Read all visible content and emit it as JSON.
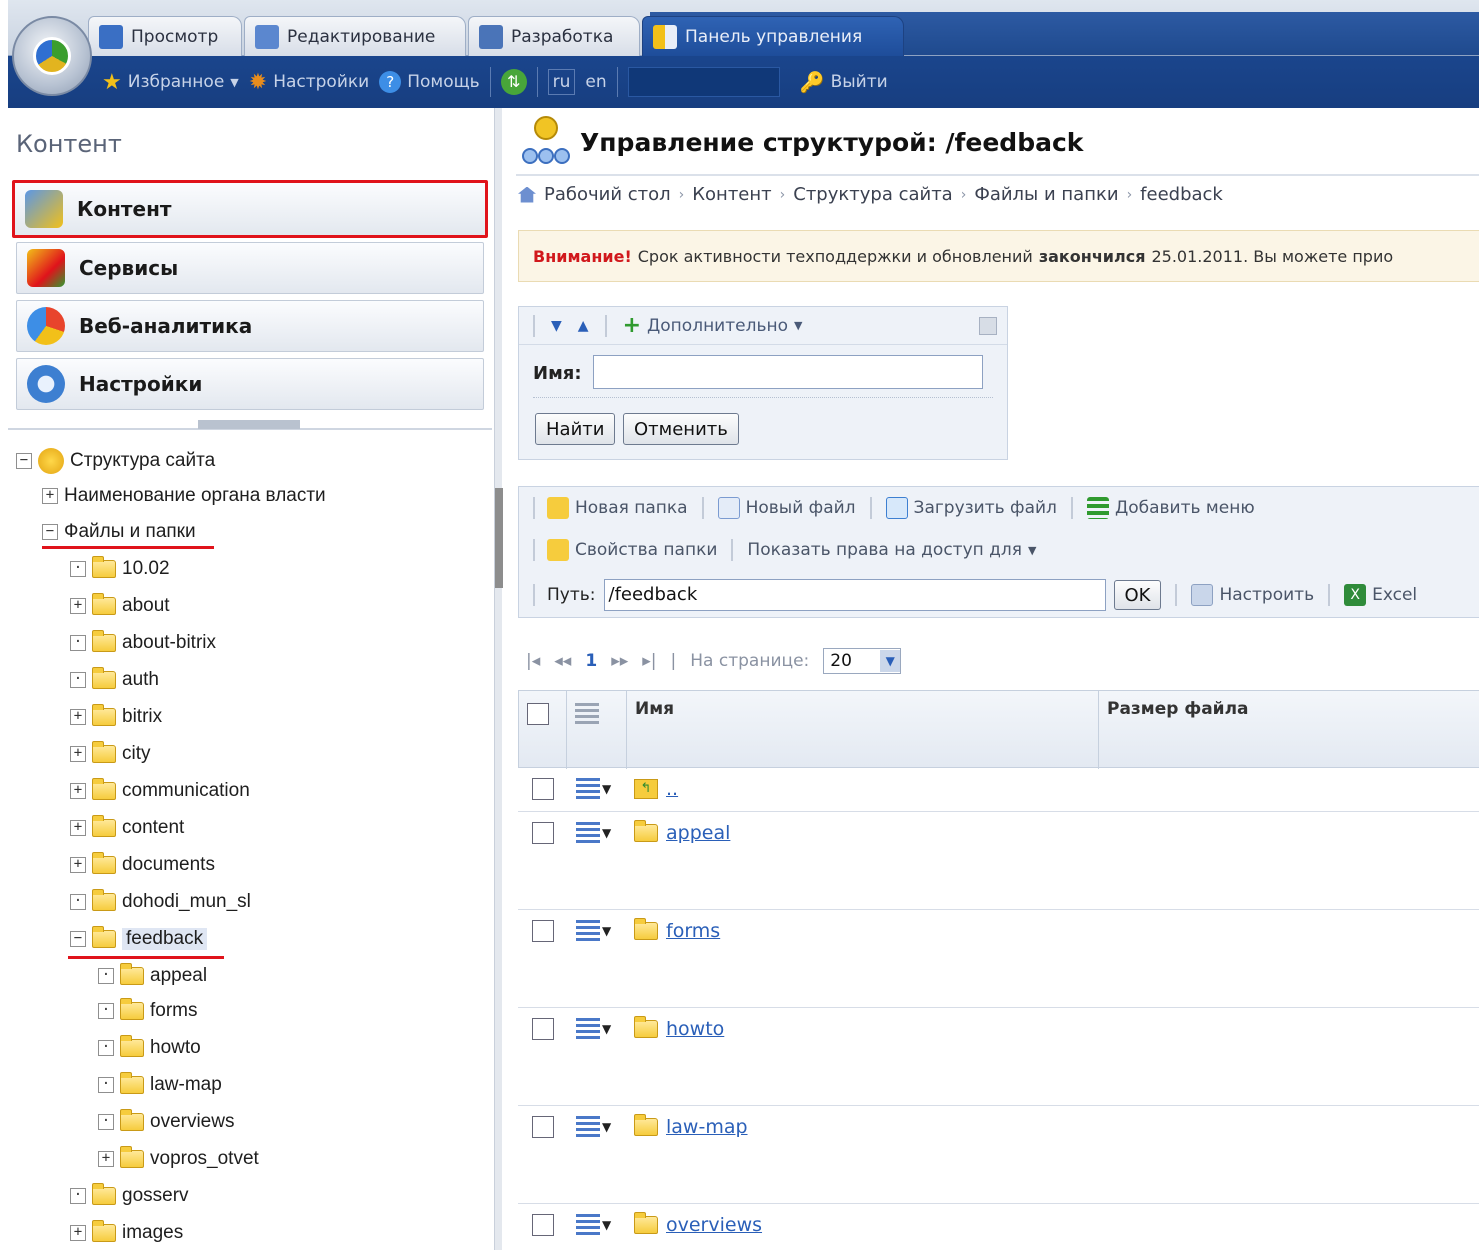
{
  "topbar": {
    "tabs": [
      {
        "label": "Просмотр",
        "icon": "monitor-icon"
      },
      {
        "label": "Редактирование",
        "icon": "edit-icon"
      },
      {
        "label": "Разработка",
        "icon": "dev-icon"
      },
      {
        "label": "Панель управления",
        "icon": "tools-icon"
      }
    ],
    "favorites": "Избранное",
    "settings": "Настройки",
    "help": "Помощь",
    "lang_ru": "ru",
    "lang_en": "en",
    "logout": "Выйти"
  },
  "left": {
    "section_title": "Контент",
    "menu": [
      "Контент",
      "Сервисы",
      "Веб-аналитика",
      "Настройки"
    ],
    "tree": {
      "root": "Структура сайта",
      "items": [
        "Наименование органа власти",
        "Файлы и папки",
        "10.02",
        "about",
        "about-bitrix",
        "auth",
        "bitrix",
        "city",
        "communication",
        "content",
        "documents",
        "dohodi_mun_sl",
        "feedback",
        "appeal",
        "forms",
        "howto",
        "law-map",
        "overviews",
        "vopros_otvet",
        "gosserv",
        "images"
      ]
    }
  },
  "main": {
    "title": "Управление структурой: /feedback",
    "breadcrumb": [
      "Рабочий стол",
      "Контент",
      "Структура сайта",
      "Файлы и папки",
      "feedback"
    ],
    "notice": {
      "warn": "Внимание!",
      "text1": "Срок активности техподдержки и обновлений",
      "bold": "закончился",
      "text2": "25.01.2011. Вы можете прио"
    },
    "filter": {
      "more": "Дополнительно",
      "name_label": "Имя:",
      "find": "Найти",
      "cancel": "Отменить"
    },
    "actions": {
      "new_folder": "Новая папка",
      "new_file": "Новый файл",
      "upload": "Загрузить файл",
      "add_menu": "Добавить меню",
      "folder_props": "Свойства папки",
      "show_access": "Показать права на доступ для",
      "path_label": "Путь:",
      "path_value": "/feedback",
      "ok": "OK",
      "configure": "Настроить",
      "excel": "Excel"
    },
    "pager": {
      "current": "1",
      "per_page_label": "На странице:",
      "per_page": "20"
    },
    "grid": {
      "col_name": "Имя",
      "col_size": "Размер файла",
      "rows": [
        "..",
        "appeal",
        "forms",
        "howto",
        "law-map",
        "overviews"
      ]
    }
  }
}
